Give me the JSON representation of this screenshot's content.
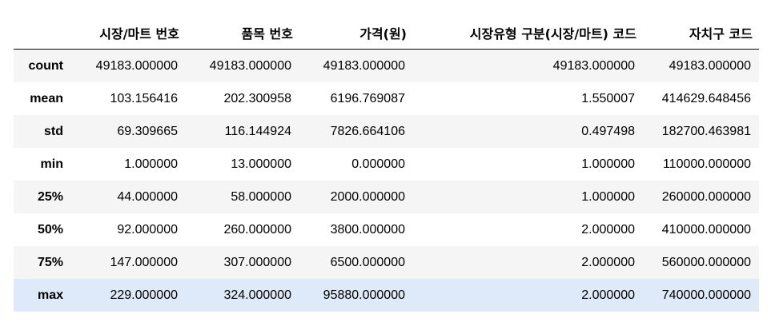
{
  "table": {
    "columns": [
      "",
      "시장/마트 번호",
      "품목 번호",
      "가격(원)",
      "시장유형 구분(시장/마트) 코드",
      "자치구 코드"
    ],
    "rows": [
      {
        "label": "count",
        "values": [
          "49183.000000",
          "49183.000000",
          "49183.000000",
          "49183.000000",
          "49183.000000"
        ]
      },
      {
        "label": "mean",
        "values": [
          "103.156416",
          "202.300958",
          "6196.769087",
          "1.550007",
          "414629.648456"
        ]
      },
      {
        "label": "std",
        "values": [
          "69.309665",
          "116.144924",
          "7826.664106",
          "0.497498",
          "182700.463981"
        ]
      },
      {
        "label": "min",
        "values": [
          "1.000000",
          "13.000000",
          "0.000000",
          "1.000000",
          "110000.000000"
        ]
      },
      {
        "label": "25%",
        "values": [
          "44.000000",
          "58.000000",
          "2000.000000",
          "1.000000",
          "260000.000000"
        ]
      },
      {
        "label": "50%",
        "values": [
          "92.000000",
          "260.000000",
          "3800.000000",
          "2.000000",
          "410000.000000"
        ]
      },
      {
        "label": "75%",
        "values": [
          "147.000000",
          "307.000000",
          "6500.000000",
          "2.000000",
          "560000.000000"
        ]
      },
      {
        "label": "max",
        "values": [
          "229.000000",
          "324.000000",
          "95880.000000",
          "2.000000",
          "740000.000000"
        ]
      }
    ]
  },
  "colors": {
    "stripe": "#f5f5f5",
    "hover_row": "#deeafa",
    "header_rule": "#000000"
  }
}
